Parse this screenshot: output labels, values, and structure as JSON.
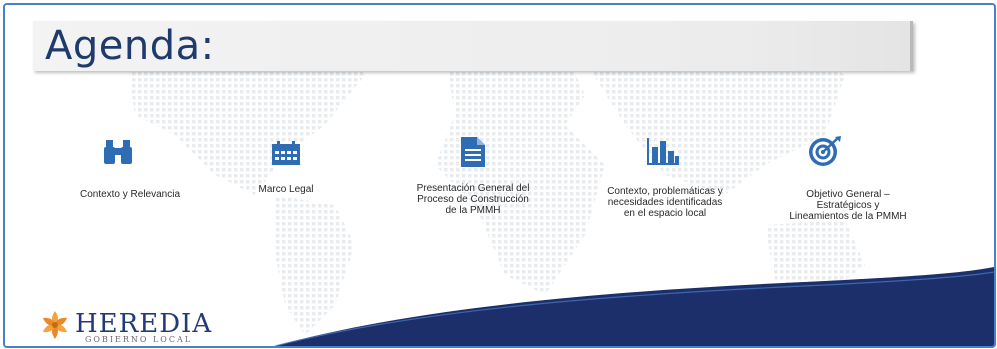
{
  "slide": {
    "title": "Agenda:",
    "items": [
      {
        "label": "Contexto y Relevancia",
        "icon": "binoculars-icon"
      },
      {
        "label": "Marco Legal",
        "icon": "calendar-icon"
      },
      {
        "label": "Presentación General del\nProceso de Construcción\nde la PMMH",
        "icon": "document-icon"
      },
      {
        "label": "Contexto, problemáticas y\nnecesidades identificadas\nen el espacio local",
        "icon": "bar-chart-icon"
      },
      {
        "label": "Objetivo General –\nEstratégicos y\nLineamientos de la PMMH",
        "icon": "target-icon"
      }
    ],
    "logo": {
      "name": "HEREDIA",
      "subtitle": "GOBIERNO LOCAL"
    }
  },
  "colors": {
    "accent": "#2e6db4",
    "title": "#1f3a6d",
    "wave_dark": "#1c2f6b",
    "border": "#4a7fc9"
  }
}
